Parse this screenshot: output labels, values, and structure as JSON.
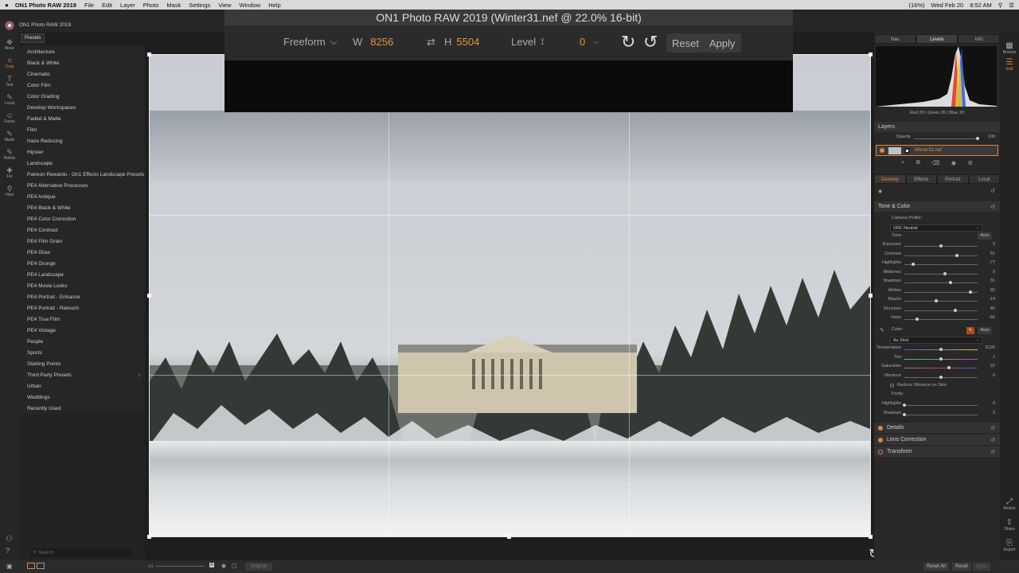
{
  "menubar": {
    "apple": "",
    "app": "ON1 Photo RAW 2019",
    "items": [
      "File",
      "Edit",
      "Layer",
      "Photo",
      "Mask",
      "Settings",
      "View",
      "Window",
      "Help"
    ],
    "status": [
      "(16%)",
      "Wed Feb 20",
      "8:52 AM"
    ]
  },
  "app_title": "ON1 Photo RAW 2019",
  "tools": [
    {
      "label": "Move",
      "icon": "✥"
    },
    {
      "label": "Crop",
      "icon": "⌗"
    },
    {
      "label": "Text",
      "icon": "T"
    },
    {
      "label": "Local",
      "icon": "✎"
    },
    {
      "label": "Faces",
      "icon": "☺"
    },
    {
      "label": "Mask",
      "icon": "✎"
    },
    {
      "label": "Refine",
      "icon": "✎"
    },
    {
      "label": "Fix",
      "icon": "✚"
    },
    {
      "label": "View",
      "icon": "⚲"
    }
  ],
  "presets": {
    "tab": "Presets",
    "items": [
      "Architecture",
      "Black & White",
      "Cinematic",
      "Color Film",
      "Color Grading",
      "Develop Workspaces",
      "Faded & Matte",
      "Film",
      "Haze Reducing",
      "Hipster",
      "Landscape",
      "Patreon Rewards - On1 Effects Landscape Presets...",
      "PE4 Alternative Processes",
      "PE4 Antique",
      "PE4 Black & White",
      "PE4 Color Correction",
      "PE4 Contrast",
      "PE4 Film Grain",
      "PE4 Glow",
      "PE4 Grunge",
      "PE4 Landscape",
      "PE4 Movie Looks",
      "PE4 Portrait - Enhance",
      "PE4 Portrait - Retouch",
      "PE4 True Film",
      "PE4 Vintage",
      "People",
      "Sports",
      "Starting Points",
      "Third Party Presets",
      "Urban",
      "Weddings",
      "Recently Used"
    ],
    "search_placeholder": "Search"
  },
  "crop": {
    "title": "ON1 Photo RAW 2019 (Winter31.nef @ 22.0% 16-bit)",
    "mode": "Freeform",
    "w_label": "W",
    "w_value": "8256",
    "h_label": "H",
    "h_value": "5504",
    "level_label": "Level",
    "angle": "0",
    "reset": "Reset",
    "apply": "Apply"
  },
  "right": {
    "nav_tabs": [
      "Nav",
      "Levels",
      "Info"
    ],
    "active_nav": 1,
    "hist_labels": "Red 20 | Green 20 | Blue 20",
    "layers_title": "Layers",
    "opacity_label": "Opacity",
    "opacity_value": "100",
    "layer_name": "Winter31.nef",
    "dev_tabs": [
      "Develop",
      "Effects",
      "Portrait",
      "Local"
    ],
    "tone_title": "Tone & Color",
    "camera_profile_label": "Camera Profile:",
    "camera_profile_value": "ON1 Neutral",
    "tone_label": "Tone:",
    "auto": "Auto",
    "sliders": [
      {
        "label": "Exposure",
        "value": "0",
        "pos": 0.5
      },
      {
        "label": "Contrast",
        "value": "51",
        "pos": 0.72
      },
      {
        "label": "Highlights",
        "value": "-77",
        "pos": 0.12
      },
      {
        "label": "Midtones",
        "value": "9",
        "pos": 0.55
      },
      {
        "label": "Shadows",
        "value": "31",
        "pos": 0.63
      },
      {
        "label": "Whites",
        "value": "82",
        "pos": 0.9
      },
      {
        "label": "Blacks",
        "value": "-14",
        "pos": 0.43
      },
      {
        "label": "Structure",
        "value": "40",
        "pos": 0.7
      },
      {
        "label": "Haze",
        "value": "-66",
        "pos": 0.17
      }
    ],
    "color_label": "Color:",
    "wb_value": "As Shot",
    "color_sliders": [
      {
        "label": "Temperature",
        "value": "6126",
        "pos": 0.5
      },
      {
        "label": "Tint",
        "value": "1",
        "pos": 0.5
      },
      {
        "label": "Saturation",
        "value": "22",
        "pos": 0.61
      },
      {
        "label": "Vibrance",
        "value": "0",
        "pos": 0.5
      }
    ],
    "reduce_vibrance": "Reduce Vibrance on Skin",
    "purity_label": "Purity:",
    "purity_sliders": [
      {
        "label": "Highlights",
        "value": "0",
        "pos": 0.0
      },
      {
        "label": "Shadows",
        "value": "0",
        "pos": 0.0
      }
    ],
    "sections": [
      "Details",
      "Lens Correction",
      "Transform"
    ]
  },
  "right_strip": [
    {
      "label": "Browse",
      "icon": "▦"
    },
    {
      "label": "Edit",
      "icon": "☰"
    },
    {
      "label": "Resize",
      "icon": "⤢"
    },
    {
      "label": "Share",
      "icon": "⇪"
    },
    {
      "label": "Export",
      "icon": "⎘"
    }
  ],
  "bottom": {
    "original": "Original",
    "reset_all": "Reset All",
    "reset": "Reset",
    "sync": "Sync"
  }
}
